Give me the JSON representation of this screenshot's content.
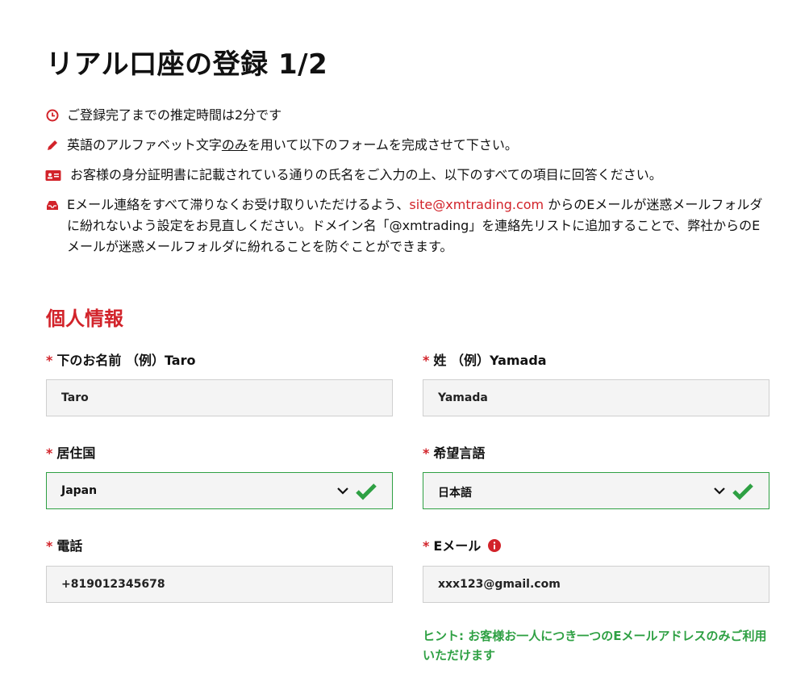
{
  "page": {
    "title": "リアル口座の登録 1/2"
  },
  "info": {
    "time": "ご登録完了までの推定時間は2分です",
    "alphabet_pre": "英語のアルファベット文字",
    "alphabet_em": "のみ",
    "alphabet_post": "を用いて以下のフォームを完成させて下さい。",
    "id_card": "お客様の身分証明書に記載されている通りの氏名をご入力の上、以下のすべての項目に回答ください。",
    "email_pre": "Eメール連絡をすべて滞りなくお受け取りいただけるよう、",
    "email_link": "site@xmtrading.com",
    "email_post": "からのEメールが迷惑メールフォルダに紛れないよう設定をお見直しください。ドメイン名「@xmtrading」を連絡先リストに追加することで、弊社からのEメールが迷惑メールフォルダに紛れることを防ぐことができます。"
  },
  "section": {
    "personal": "個人情報"
  },
  "form": {
    "required_mark": "*",
    "first_name": {
      "label": "下のお名前 （例）Taro",
      "value": "Taro"
    },
    "last_name": {
      "label": "姓 （例）Yamada",
      "value": "Yamada"
    },
    "country": {
      "label": "居住国",
      "value": "Japan"
    },
    "language": {
      "label": "希望言語",
      "value": "日本語"
    },
    "phone": {
      "label": "電話",
      "value": "+819012345678"
    },
    "email": {
      "label": "Eメール",
      "value": "xxx123@gmail.com"
    }
  },
  "hint": "ヒント: お客様お一人につき一つのEメールアドレスのみご利用いただけます",
  "colors": {
    "accent": "#d2232a",
    "success": "#2ea043",
    "field_bg": "#f4f4f4"
  }
}
